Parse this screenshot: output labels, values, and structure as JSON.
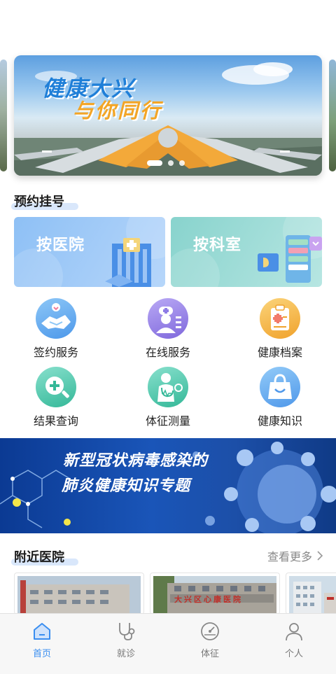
{
  "banner": {
    "line1": "健康大兴",
    "line2": "与你同行",
    "slides": 3,
    "active_slide": 1
  },
  "booking": {
    "title": "预约挂号",
    "by_hospital": "按医院",
    "by_department": "按科室"
  },
  "services": [
    {
      "label": "签约服务",
      "icon": "handshake-icon",
      "color": "#5aa9ee"
    },
    {
      "label": "在线服务",
      "icon": "doctor-icon",
      "color": "#8f7ce6"
    },
    {
      "label": "健康档案",
      "icon": "clipboard-icon",
      "color": "#f4b13c"
    },
    {
      "label": "结果查询",
      "icon": "search-plus-icon",
      "color": "#3fc3a8"
    },
    {
      "label": "体征测量",
      "icon": "stethoscope-person-icon",
      "color": "#3fc3a8"
    },
    {
      "label": "健康知识",
      "icon": "bag-icon",
      "color": "#5aa9ee"
    }
  ],
  "covid_banner": {
    "line1": "新型冠状病毒感染的",
    "line2": "肺炎健康知识专题"
  },
  "nearby": {
    "title": "附近医院",
    "more": "查看更多",
    "hospital_sign": "大兴区心康医院"
  },
  "tabbar": [
    {
      "label": "首页",
      "icon": "home-icon",
      "active": true
    },
    {
      "label": "就诊",
      "icon": "stethoscope-icon",
      "active": false
    },
    {
      "label": "体征",
      "icon": "gauge-icon",
      "active": false
    },
    {
      "label": "个人",
      "icon": "person-icon",
      "active": false
    }
  ],
  "colors": {
    "accent": "#3a8ef0",
    "title_blue": "#1f7fd8",
    "title_orange": "#f3a526"
  }
}
